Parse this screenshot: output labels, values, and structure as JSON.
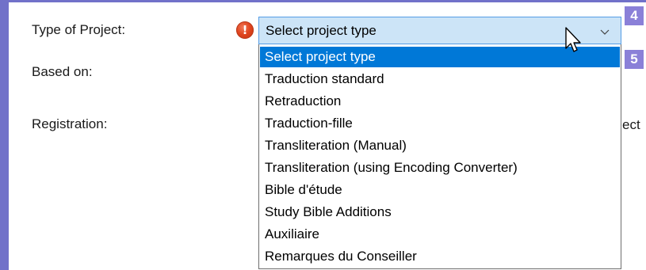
{
  "form": {
    "type_of_project_label": "Type of Project:",
    "based_on_label": "Based on:",
    "registration_label": "Registration:",
    "partial_text": "ect"
  },
  "combo": {
    "selected_value": "Select project type",
    "error_icon": "error-exclamation-icon",
    "error_symbol": "!"
  },
  "badges": {
    "first": "4",
    "second": "5"
  },
  "dropdown": {
    "options": [
      {
        "label": "Select project type",
        "selected": true
      },
      {
        "label": "Traduction standard",
        "selected": false
      },
      {
        "label": "Retraduction",
        "selected": false
      },
      {
        "label": "Traduction-fille",
        "selected": false
      },
      {
        "label": "Transliteration (Manual)",
        "selected": false
      },
      {
        "label": "Transliteration (using Encoding Converter)",
        "selected": false
      },
      {
        "label": "Bible d'étude",
        "selected": false
      },
      {
        "label": "Study Bible Additions",
        "selected": false
      },
      {
        "label": "Auxiliaire",
        "selected": false
      },
      {
        "label": "Remarques du Conseiller",
        "selected": false
      }
    ]
  },
  "colors": {
    "frame": "#7171c9",
    "badge": "#8a80d8",
    "combo_bg": "#cce4f7",
    "selection": "#0078d7",
    "error": "#e0441e"
  }
}
